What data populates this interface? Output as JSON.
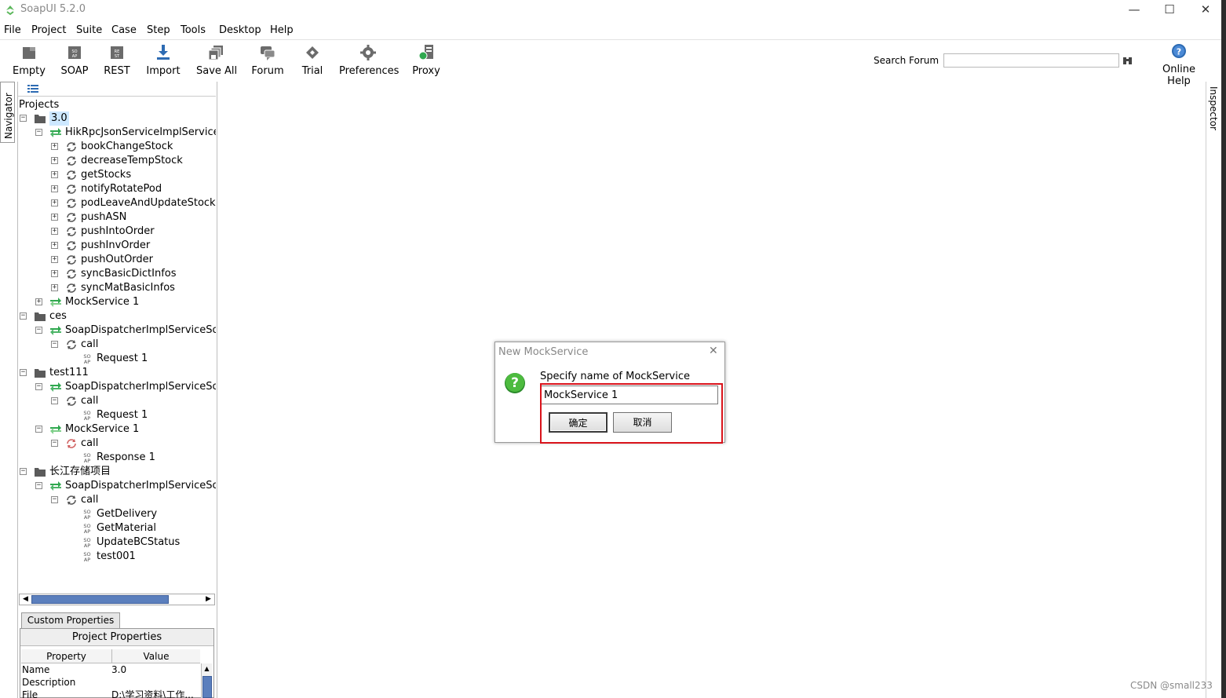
{
  "app": {
    "title": "SoapUI 5.2.0"
  },
  "window_controls": {
    "minimize": "—",
    "maximize": "☐",
    "close": "✕"
  },
  "menu": [
    "File",
    "Project",
    "Suite",
    "Case",
    "Step",
    "Tools",
    "Desktop",
    "Help"
  ],
  "toolbar": {
    "items": [
      {
        "label": "Empty",
        "icon": "empty-project-icon"
      },
      {
        "label": "SOAP",
        "icon": "soap-icon"
      },
      {
        "label": "REST",
        "icon": "rest-icon"
      },
      {
        "label": "Import",
        "icon": "import-icon"
      },
      {
        "label": "Save All",
        "icon": "save-all-icon"
      },
      {
        "label": "Forum",
        "icon": "forum-icon"
      },
      {
        "label": "Trial",
        "icon": "trial-icon"
      },
      {
        "label": "Preferences",
        "icon": "gear-icon"
      },
      {
        "label": "Proxy",
        "icon": "proxy-icon"
      }
    ],
    "search_label": "Search Forum",
    "search_value": "",
    "online_help_label": "Online Help"
  },
  "side_tabs": {
    "navigator": "Navigator",
    "inspector": "Inspector"
  },
  "navigator": {
    "projects_label": "Projects",
    "tree": [
      {
        "label": "3.0",
        "type": "project",
        "level": 0,
        "expanded": true,
        "selected": true
      },
      {
        "label": "HikRpcJsonServiceImplServiceSo",
        "type": "interface",
        "level": 1,
        "expanded": true
      },
      {
        "label": "bookChangeStock",
        "type": "operation",
        "level": 2,
        "expanded": false
      },
      {
        "label": "decreaseTempStock",
        "type": "operation",
        "level": 2,
        "expanded": false
      },
      {
        "label": "getStocks",
        "type": "operation",
        "level": 2,
        "expanded": false
      },
      {
        "label": "notifyRotatePod",
        "type": "operation",
        "level": 2,
        "expanded": false
      },
      {
        "label": "podLeaveAndUpdateStock",
        "type": "operation",
        "level": 2,
        "expanded": false
      },
      {
        "label": "pushASN",
        "type": "operation",
        "level": 2,
        "expanded": false
      },
      {
        "label": "pushIntoOrder",
        "type": "operation",
        "level": 2,
        "expanded": false
      },
      {
        "label": "pushInvOrder",
        "type": "operation",
        "level": 2,
        "expanded": false
      },
      {
        "label": "pushOutOrder",
        "type": "operation",
        "level": 2,
        "expanded": false
      },
      {
        "label": "syncBasicDictInfos",
        "type": "operation",
        "level": 2,
        "expanded": false
      },
      {
        "label": "syncMatBasicInfos",
        "type": "operation",
        "level": 2,
        "expanded": false
      },
      {
        "label": "MockService 1",
        "type": "mock",
        "level": 1,
        "expanded": false
      },
      {
        "label": "ces",
        "type": "project",
        "level": 0,
        "expanded": true
      },
      {
        "label": "SoapDispatcherImplServiceSoap",
        "type": "interface",
        "level": 1,
        "expanded": true
      },
      {
        "label": "call",
        "type": "operation",
        "level": 2,
        "expanded": true
      },
      {
        "label": "Request 1",
        "type": "request",
        "level": 3
      },
      {
        "label": "test111",
        "type": "project",
        "level": 0,
        "expanded": true
      },
      {
        "label": "SoapDispatcherImplServiceSoap",
        "type": "interface",
        "level": 1,
        "expanded": true
      },
      {
        "label": "call",
        "type": "operation",
        "level": 2,
        "expanded": true
      },
      {
        "label": "Request 1",
        "type": "request",
        "level": 3
      },
      {
        "label": "MockService 1",
        "type": "mock",
        "level": 1,
        "expanded": true
      },
      {
        "label": "call",
        "type": "mockop",
        "level": 2,
        "expanded": true
      },
      {
        "label": "Response 1",
        "type": "request",
        "level": 3
      },
      {
        "label": "长江存储项目",
        "type": "project",
        "level": 0,
        "expanded": true
      },
      {
        "label": "SoapDispatcherImplServiceSoap",
        "type": "interface",
        "level": 1,
        "expanded": true
      },
      {
        "label": "call",
        "type": "operation",
        "level": 2,
        "expanded": true
      },
      {
        "label": "GetDelivery",
        "type": "request",
        "level": 3
      },
      {
        "label": "GetMaterial",
        "type": "request",
        "level": 3
      },
      {
        "label": "UpdateBCStatus",
        "type": "request",
        "level": 3
      },
      {
        "label": "test001",
        "type": "request",
        "level": 3
      }
    ]
  },
  "properties": {
    "tab_label": "Custom Properties",
    "title": "Project Properties",
    "headers": [
      "Property",
      "Value"
    ],
    "rows": [
      [
        "Name",
        "3.0"
      ],
      [
        "Description",
        ""
      ],
      [
        "File",
        "D:\\学习资料\\工作..."
      ]
    ]
  },
  "dialog": {
    "title": "New MockService",
    "prompt": "Specify name of MockService",
    "input_value": "MockService 1",
    "ok_label": "确定",
    "cancel_label": "取消",
    "close_glyph": "✕"
  },
  "watermark": "CSDN @small233",
  "colors": {
    "accent_green": "#2fa84f",
    "highlight_red": "#d9131b",
    "scroll_blue": "#5b7fbd",
    "selected_bg": "#cde8ff"
  }
}
